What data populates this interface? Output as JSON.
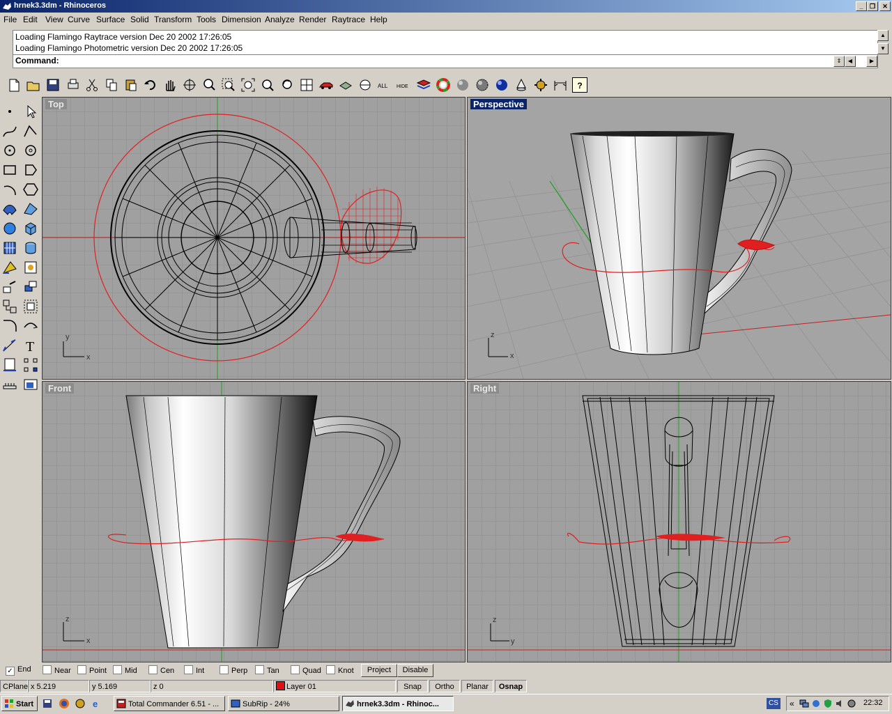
{
  "window": {
    "title": "hrnek3.3dm - Rhinoceros",
    "min_label": "_",
    "max_label": "❐",
    "close_label": "✕"
  },
  "menu": [
    "File",
    "Edit",
    "View",
    "Curve",
    "Surface",
    "Solid",
    "Transform",
    "Tools",
    "Dimension",
    "Analyze",
    "Render",
    "Raytrace",
    "Help"
  ],
  "command": {
    "history": [
      "Loading Flamingo Raytrace version Dec 20 2002 17:26:05",
      "Loading Flamingo Photometric version Dec 20 2002 17:26:05"
    ],
    "prompt": "Command:"
  },
  "toolbar": {
    "all_label": "ALL",
    "hide_label": "HIDE",
    "help_label": "?"
  },
  "left_toolbar": {
    "text_tool_label": "T"
  },
  "viewports": {
    "top": {
      "label": "Top",
      "axis_y": "y",
      "axis_x": "x"
    },
    "perspective": {
      "label": "Perspective",
      "axis_z": "z",
      "axis_x": "x"
    },
    "front": {
      "label": "Front",
      "axis_z": "z",
      "axis_x": "x"
    },
    "right": {
      "label": "Right",
      "axis_z": "z",
      "axis_y": "y"
    }
  },
  "osnap": {
    "items": [
      {
        "label": "End",
        "checked": true
      },
      {
        "label": "Near",
        "checked": false
      },
      {
        "label": "Point",
        "checked": false
      },
      {
        "label": "Mid",
        "checked": false
      },
      {
        "label": "Cen",
        "checked": false
      },
      {
        "label": "Int",
        "checked": false
      },
      {
        "label": "Perp",
        "checked": false
      },
      {
        "label": "Tan",
        "checked": false
      },
      {
        "label": "Quad",
        "checked": false
      },
      {
        "label": "Knot",
        "checked": false
      }
    ],
    "project_label": "Project",
    "disable_label": "Disable"
  },
  "status": {
    "cplane": "CPlane",
    "x": "x 5.219",
    "y": "y 5.169",
    "z": "z 0",
    "layer": "Layer 01",
    "layer_color": "#e01010",
    "snap": "Snap",
    "ortho": "Ortho",
    "planar": "Planar",
    "osnap": "Osnap"
  },
  "taskbar": {
    "start": "Start",
    "tasks": [
      "Total Commander 6.51 - ...",
      "SubRip - 24%",
      "hrnek3.3dm - Rhinoc..."
    ],
    "lang": "CS",
    "chevron": "«",
    "clock": "22:32"
  }
}
